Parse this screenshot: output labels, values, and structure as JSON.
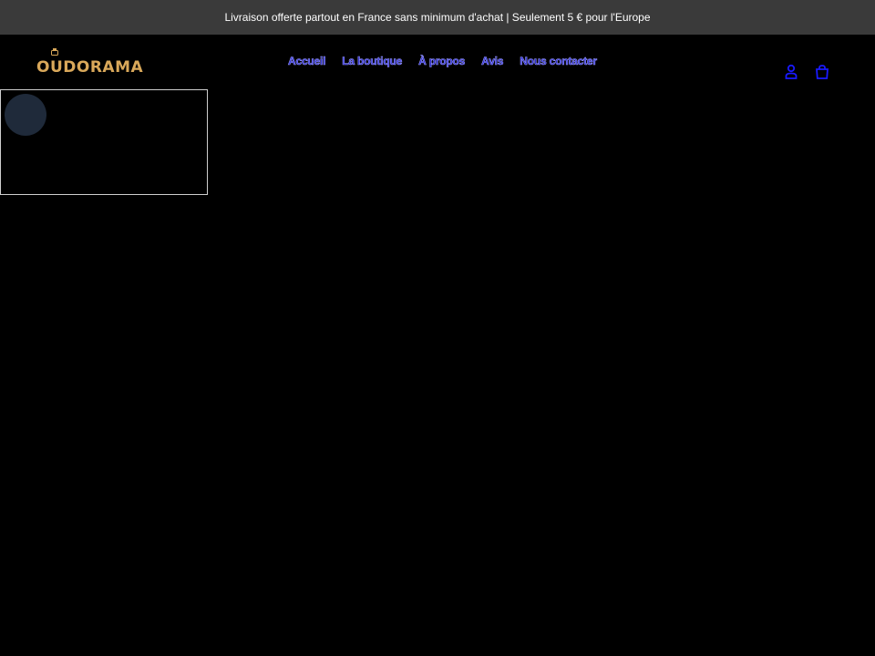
{
  "announcement": {
    "text": "Livraison offerte partout en France sans minimum d'achat | Seulement 5 € pour l'Europe"
  },
  "header": {
    "logo_text": "OUDORAMA",
    "nav": [
      {
        "label": "Accueil"
      },
      {
        "label": "La boutique"
      },
      {
        "label": "À propos"
      },
      {
        "label": "Avis"
      },
      {
        "label": "Nous contacter"
      }
    ],
    "icons": {
      "account": "account-icon",
      "cart": "cart-icon"
    }
  },
  "colors": {
    "background": "#000000",
    "announcement_bg": "#3a3a3a",
    "logo_gold": "#d9a85a",
    "nav_link": "#2b2bcc",
    "icon_blue": "#1a1aff"
  }
}
